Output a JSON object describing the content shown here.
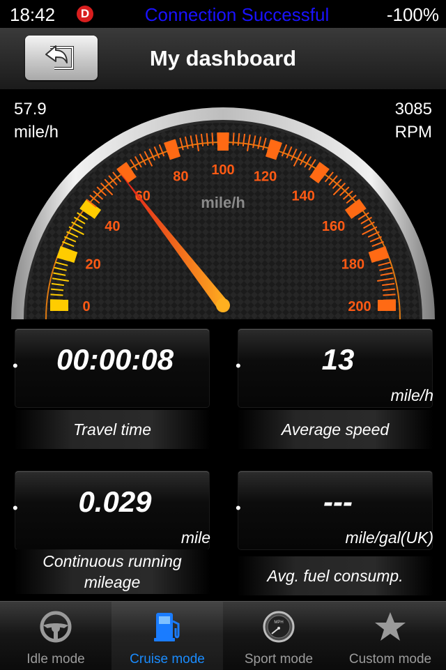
{
  "status_bar": {
    "time": "18:42",
    "badge": "D",
    "message": "Connection Successful",
    "battery": "-100%"
  },
  "nav": {
    "title": "My dashboard",
    "back_icon": "return-arrow-icon"
  },
  "gauge": {
    "speed_value": "57.9",
    "speed_unit": "mile/h",
    "rpm_value": "3085",
    "rpm_unit": "RPM",
    "dial_unit": "mile/h",
    "scale_labels": [
      "0",
      "20",
      "40",
      "60",
      "80",
      "100",
      "120",
      "140",
      "160",
      "180",
      "200"
    ],
    "max": 200,
    "needle_value": 57.9,
    "colors": {
      "tick": "#ff6a14",
      "label": "#ff5a14",
      "needle": "#ff9a20",
      "low": "#ffcc00"
    }
  },
  "tiles": [
    {
      "value": "00:00:08",
      "unit": "",
      "label": "Travel time"
    },
    {
      "value": "13",
      "unit": "mile/h",
      "label": "Average speed"
    },
    {
      "value": "0.029",
      "unit": "mile",
      "label": "Continuous running mileage"
    },
    {
      "value": "---",
      "unit": "mile/gal(UK)",
      "label": "Avg. fuel consump."
    }
  ],
  "tabs": [
    {
      "label": "Idle mode",
      "icon": "steering-wheel-icon",
      "active": false
    },
    {
      "label": "Cruise mode",
      "icon": "fuel-pump-icon",
      "active": true
    },
    {
      "label": "Sport mode",
      "icon": "speedometer-icon",
      "active": false
    },
    {
      "label": "Custom mode",
      "icon": "star-icon",
      "active": false
    }
  ]
}
